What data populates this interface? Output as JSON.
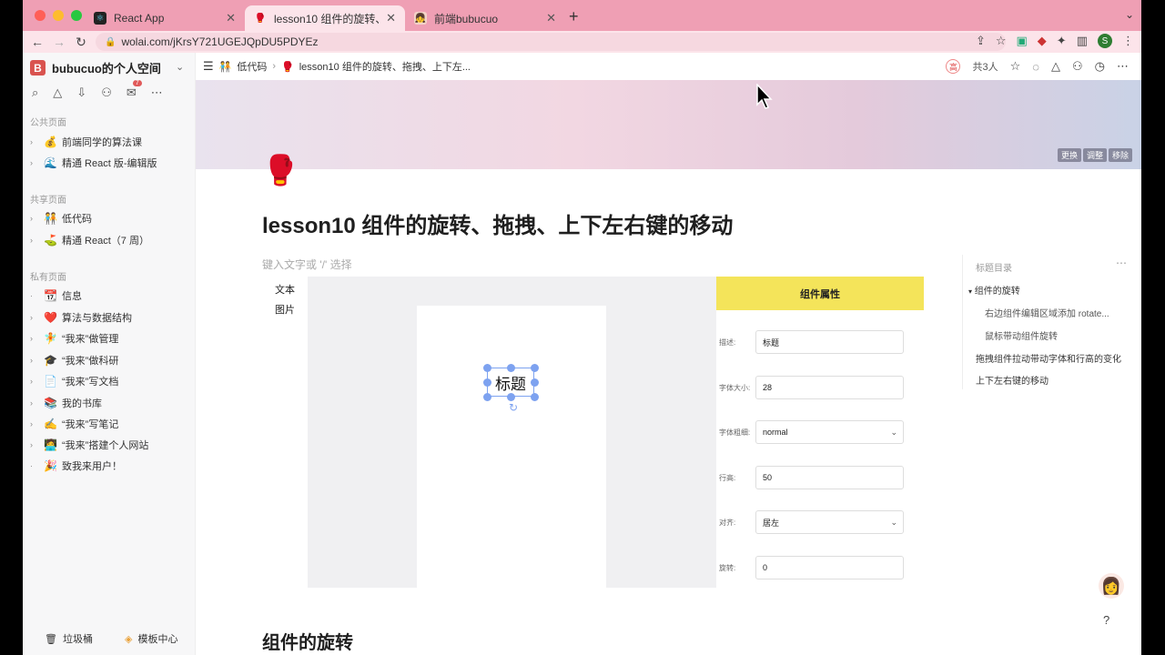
{
  "browser": {
    "tabs": [
      {
        "title": "React App",
        "icon": "react-icon"
      },
      {
        "title": "lesson10 组件的旋转、拖拽、上",
        "icon": "boxing-glove-icon"
      },
      {
        "title": "前端bubucuo",
        "icon": "avatar-icon"
      }
    ],
    "new_tab": "+",
    "url": "wolai.com/jKrsY721UGEJQpDU5PDYEz",
    "profile": "S"
  },
  "sidebar": {
    "workspace": "bubucuo的个人空间",
    "workspace_logo": "B",
    "inbox_badge": "7",
    "sections": [
      {
        "title": "公共页面",
        "items": [
          {
            "label": "前端同学的算法课",
            "icon": "💰"
          },
          {
            "label": "精通 React 版-编辑版",
            "icon": "🌊"
          }
        ]
      },
      {
        "title": "共享页面",
        "items": [
          {
            "label": "低代码",
            "icon": "🧑‍🤝‍🧑"
          },
          {
            "label": "精通 React（7 周）",
            "icon": "⛳"
          }
        ]
      },
      {
        "title": "私有页面",
        "items": [
          {
            "label": "信息",
            "icon": "📆"
          },
          {
            "label": "算法与数据结构",
            "icon": "❤️"
          },
          {
            "label": "“我来”做管理",
            "icon": "🧚"
          },
          {
            "label": "“我来”做科研",
            "icon": "🎓"
          },
          {
            "label": "“我来”写文档",
            "icon": "📄"
          },
          {
            "label": "我的书库",
            "icon": "📚"
          },
          {
            "label": "“我来”写笔记",
            "icon": "✍️"
          },
          {
            "label": "“我来”搭建个人网站",
            "icon": "🧑‍💻"
          },
          {
            "label": "致我来用户！",
            "icon": "🎉"
          }
        ]
      }
    ],
    "trash": "垃圾桶",
    "templates": "模板中心"
  },
  "topbar": {
    "breadcrumb_parent": "低代码",
    "breadcrumb_current": "lesson10 组件的旋转、拖拽、上下左...",
    "priority": "高",
    "member_count": "共3人"
  },
  "page": {
    "cover_actions": [
      "更换",
      "调整",
      "移除"
    ],
    "emoji": "🥊",
    "title": "lesson10 组件的旋转、拖拽、上下左右键的移动",
    "placeholder": "键入文字或 '/' 选择",
    "section_heading": "组件的旋转"
  },
  "demo": {
    "left_items": [
      "文本",
      "图片"
    ],
    "component_text": "标题",
    "panel_title": "组件属性",
    "fields": [
      {
        "label": "描述:",
        "value": "标题",
        "type": "input"
      },
      {
        "label": "字体大小:",
        "value": "28",
        "type": "input"
      },
      {
        "label": "字体粗细:",
        "value": "normal",
        "type": "select"
      },
      {
        "label": "行高:",
        "value": "50",
        "type": "input"
      },
      {
        "label": "对齐:",
        "value": "居左",
        "type": "select"
      },
      {
        "label": "旋转:",
        "value": "0",
        "type": "input"
      }
    ]
  },
  "toc": {
    "title": "标题目录",
    "items": [
      {
        "label": "组件的旋转",
        "level": 1,
        "expanded": true
      },
      {
        "label": "右边组件编辑区域添加 rotate...",
        "level": 2
      },
      {
        "label": "鼠标带动组件旋转",
        "level": 2
      },
      {
        "label": "拖拽组件拉动带动字体和行高的变化",
        "level": 1
      },
      {
        "label": "上下左右键的移动",
        "level": 1
      }
    ]
  },
  "colors": {
    "tabbar": "#ef9fb4",
    "panel_header": "#f4e45a",
    "selection": "#7da2f0"
  }
}
